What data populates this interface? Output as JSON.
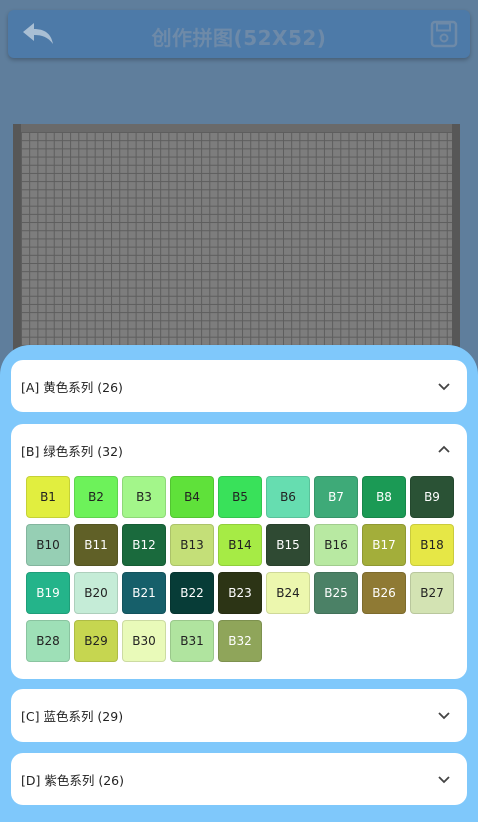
{
  "header": {
    "title": "创作拼图(52X52)"
  },
  "sections": [
    {
      "label": "[A] 黄色系列 (26)",
      "expanded": false
    },
    {
      "label": "[B] 绿色系列 (32)",
      "expanded": true
    },
    {
      "label": "[C] 蓝色系列 (29)",
      "expanded": false
    },
    {
      "label": "[D] 紫色系列 (26)",
      "expanded": false
    }
  ],
  "colors": {
    "header_bg": "#4d7aa8",
    "sheet_bg": "#7fc8fb",
    "grid_bg": "#7d7d7d"
  },
  "icons": {
    "back": "back-arrow-icon",
    "save": "floppy-disk-icon",
    "collapsed": "chevron-down-icon",
    "expanded": "chevron-up-icon"
  },
  "green_swatches": [
    {
      "label": "B1",
      "color": "#e1ee3f",
      "text": "#222"
    },
    {
      "label": "B2",
      "color": "#6df25a",
      "text": "#222"
    },
    {
      "label": "B3",
      "color": "#a3f68a",
      "text": "#222"
    },
    {
      "label": "B4",
      "color": "#5fe13a",
      "text": "#222"
    },
    {
      "label": "B5",
      "color": "#39e15a",
      "text": "#222"
    },
    {
      "label": "B6",
      "color": "#66ddb0",
      "text": "#222"
    },
    {
      "label": "B7",
      "color": "#3eaa78",
      "text": "#fff"
    },
    {
      "label": "B8",
      "color": "#1b9a55",
      "text": "#fff"
    },
    {
      "label": "B9",
      "color": "#2a5235",
      "text": "#fff"
    },
    {
      "label": "B10",
      "color": "#96cfb4",
      "text": "#222"
    },
    {
      "label": "B11",
      "color": "#606027",
      "text": "#fff"
    },
    {
      "label": "B12",
      "color": "#1a6a3d",
      "text": "#fff"
    },
    {
      "label": "B13",
      "color": "#c4df78",
      "text": "#222"
    },
    {
      "label": "B14",
      "color": "#a6eb45",
      "text": "#222"
    },
    {
      "label": "B15",
      "color": "#2f4a33",
      "text": "#fff"
    },
    {
      "label": "B16",
      "color": "#b8e9a2",
      "text": "#222"
    },
    {
      "label": "B17",
      "color": "#a3ae3a",
      "text": "#fff"
    },
    {
      "label": "B18",
      "color": "#e6e746",
      "text": "#222"
    },
    {
      "label": "B19",
      "color": "#24b48a",
      "text": "#fff"
    },
    {
      "label": "B20",
      "color": "#c5ecd7",
      "text": "#222"
    },
    {
      "label": "B21",
      "color": "#165f6a",
      "text": "#fff"
    },
    {
      "label": "B22",
      "color": "#073c37",
      "text": "#fff"
    },
    {
      "label": "B23",
      "color": "#2c3415",
      "text": "#fff"
    },
    {
      "label": "B24",
      "color": "#ecf7ae",
      "text": "#222"
    },
    {
      "label": "B25",
      "color": "#4b8166",
      "text": "#fff"
    },
    {
      "label": "B26",
      "color": "#8f7a34",
      "text": "#fff"
    },
    {
      "label": "B27",
      "color": "#d3e3b3",
      "text": "#222"
    },
    {
      "label": "B28",
      "color": "#9ee0b7",
      "text": "#222"
    },
    {
      "label": "B29",
      "color": "#c6d650",
      "text": "#222"
    },
    {
      "label": "B30",
      "color": "#e9fab9",
      "text": "#222"
    },
    {
      "label": "B31",
      "color": "#b0e49f",
      "text": "#222"
    },
    {
      "label": "B32",
      "color": "#8fa55a",
      "text": "#fff"
    }
  ]
}
